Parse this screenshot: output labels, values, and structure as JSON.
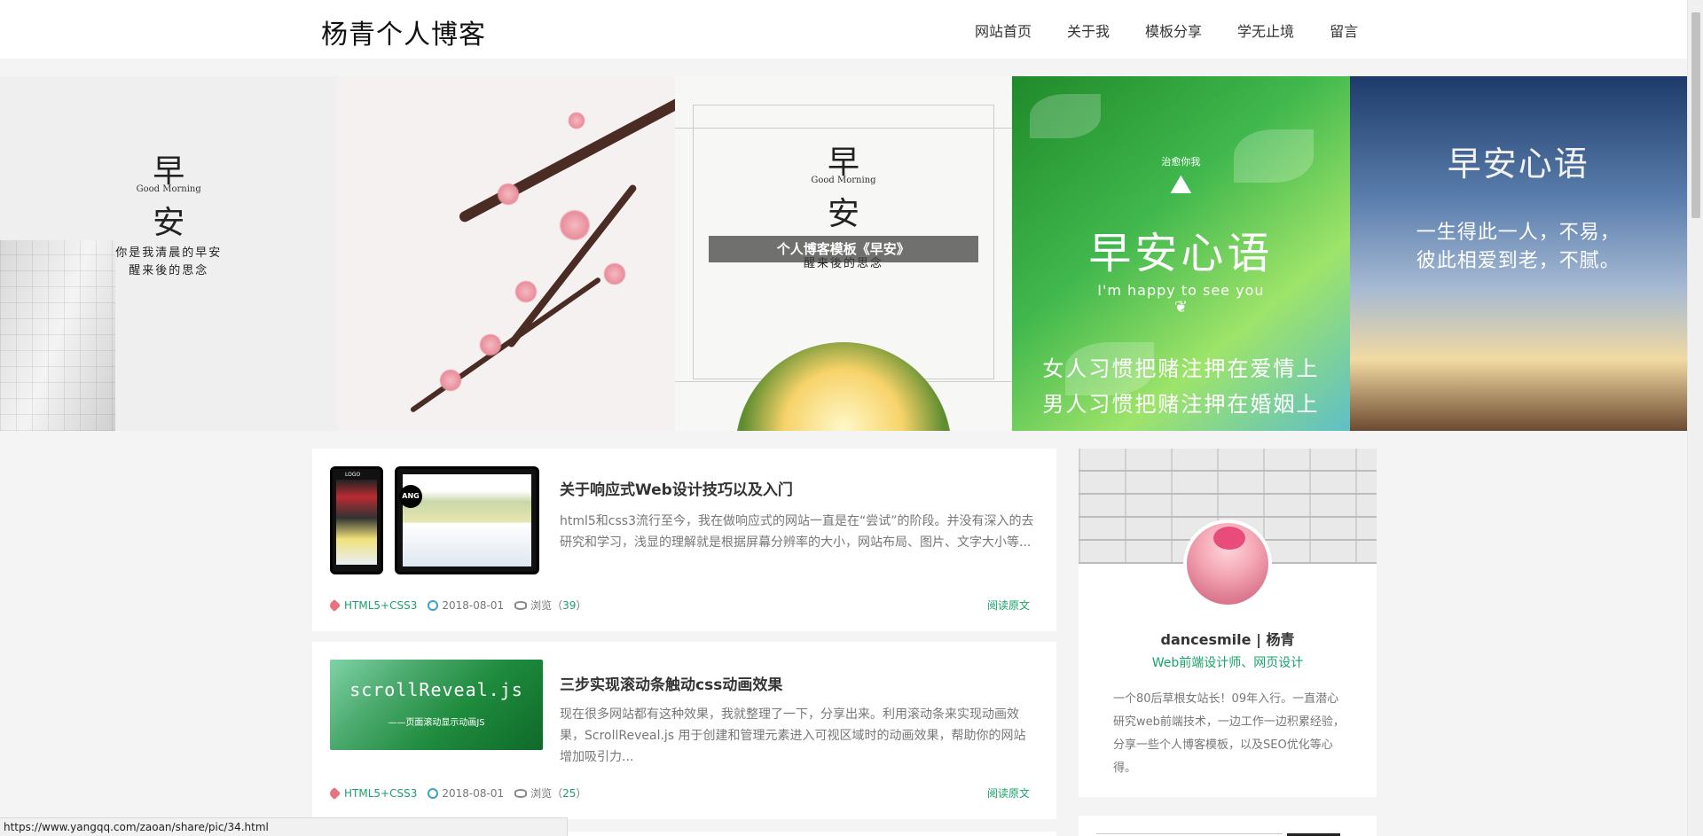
{
  "header": {
    "logo": "杨青个人博客",
    "nav": [
      "网站首页",
      "关于我",
      "模板分享",
      "学无止境",
      "留言"
    ]
  },
  "banner": {
    "panel1": {
      "char1": "早",
      "eng": "Good Morning",
      "char2": "安",
      "line1": "你是我清晨的早安",
      "line2": "醒来後的思念"
    },
    "panel3": {
      "char1": "早",
      "eng": "Good Morning",
      "char2": "安",
      "caption": "个人博客模板《早安》",
      "line2": "醒来後的思念"
    },
    "panel4": {
      "top": "治愈你我",
      "title": "早安心语",
      "eng": "I'm happy to see you",
      "line1": "女人习惯把赌注押在爱情上",
      "line2": "男人习惯把赌注押在婚姻上"
    },
    "panel5": {
      "title": "早安心语",
      "line1": "一生得此一人，不易，",
      "line2": "彼此相爱到老，不腻。"
    }
  },
  "posts": [
    {
      "title": "关于响应式Web设计技巧以及入门",
      "excerpt": "html5和css3流行至今，我在做响应式的网站一直是在“尝试”的阶段。并没有深入的去研究和学习，浅显的理解就是根据屏幕分辨率的大小，网站布局、图片、文字大小等...",
      "tag": "HTML5+CSS3",
      "date": "2018-08-01",
      "views_label": "浏览（",
      "views": "39",
      "views_end": "）",
      "read_more": "阅读原文",
      "thumb_badge": "ANG",
      "thumb_phone_text": "LOGO"
    },
    {
      "title": "三步实现滚动条触动css动画效果",
      "excerpt": "现在很多网站都有这种效果，我就整理了一下，分享出来。利用滚动条来实现动画效果，ScrollReveal.js 用于创建和管理元素进入可视区域时的动画效果，帮助你的网站增加吸引力...",
      "tag": "HTML5+CSS3",
      "date": "2018-08-01",
      "views_label": "浏览（",
      "views": "25",
      "views_end": "）",
      "read_more": "阅读原文",
      "thumb_title": "scrollReveal.js",
      "thumb_sub": "——页面滚动显示动画JS"
    }
  ],
  "sidebar": {
    "name": "dancesmile | 杨青",
    "role": "Web前端设计师、网页设计",
    "bio": "一个80后草根女站长！09年入行。一直潜心研究web前端技术，一边工作一边积累经验，分享一些个人博客模板，以及SEO优化等心得。"
  },
  "statusbar": {
    "url": "https://www.yangqq.com/zaoan/share/pic/34.html"
  },
  "colors": {
    "accent": "#1aa36a",
    "tag": "#e7737d",
    "clock": "#3aa3c8"
  }
}
